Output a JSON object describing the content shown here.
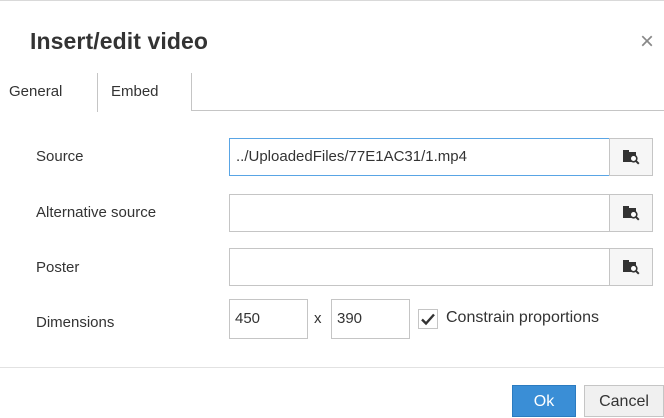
{
  "dialog": {
    "title": "Insert/edit video",
    "close_glyph": "×"
  },
  "tabs": [
    {
      "label": "General",
      "active": true
    },
    {
      "label": "Embed",
      "active": false
    }
  ],
  "general": {
    "source": {
      "label": "Source",
      "value": "../UploadedFiles/77E1AC31/1.mp4",
      "browse_icon": "browse-folder-icon"
    },
    "alternative_source": {
      "label": "Alternative source",
      "value": "",
      "browse_icon": "browse-folder-icon"
    },
    "poster": {
      "label": "Poster",
      "value": "",
      "browse_icon": "browse-folder-icon"
    },
    "dimensions": {
      "label": "Dimensions",
      "width": "450",
      "separator": "x",
      "height": "390",
      "constrain_label": "Constrain proportions",
      "constrain_checked": true
    }
  },
  "footer": {
    "ok_label": "Ok",
    "cancel_label": "Cancel"
  },
  "colors": {
    "primary_button": "#3a8ed6",
    "focus_border": "#59a5e5",
    "border": "#c5c5c5"
  }
}
